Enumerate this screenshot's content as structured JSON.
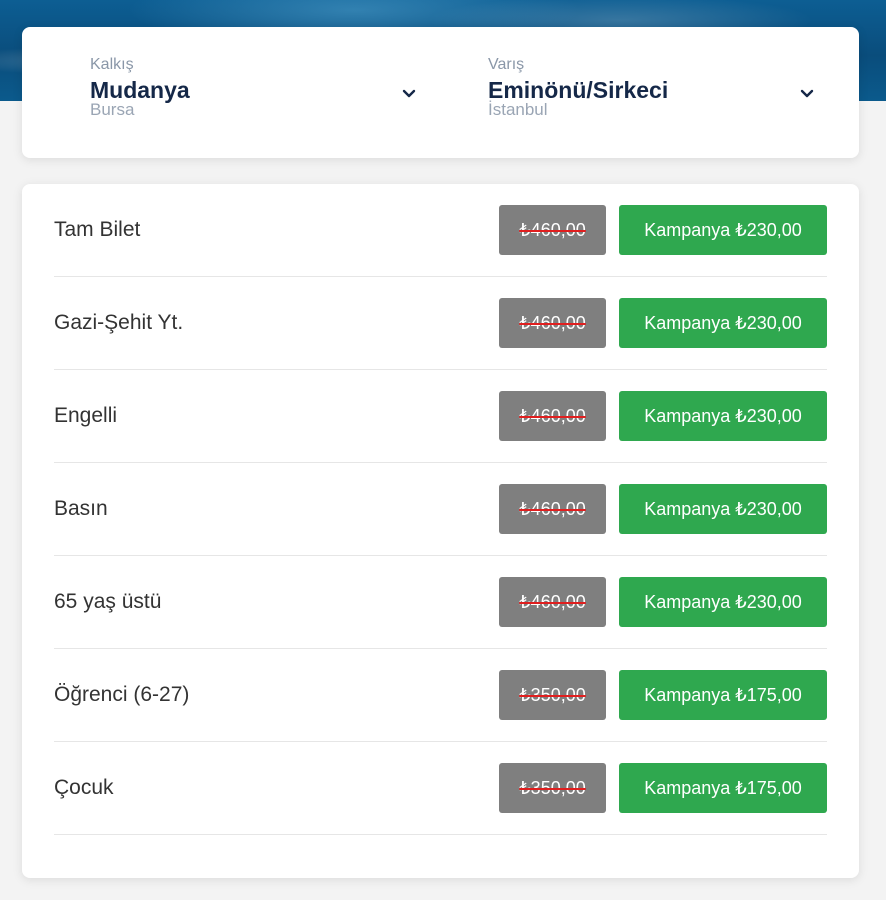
{
  "route": {
    "from": {
      "label": "Kalkış",
      "name": "Mudanya",
      "city": "Bursa"
    },
    "to": {
      "label": "Varış",
      "name": "Eminönü/Sirkeci",
      "city": "İstanbul"
    }
  },
  "tickets": [
    {
      "title": "Tam Bilet",
      "old_price": "₺460,00",
      "campaign": "Kampanya ₺230,00"
    },
    {
      "title": "Gazi-Şehit Yt.",
      "old_price": "₺460,00",
      "campaign": "Kampanya ₺230,00"
    },
    {
      "title": "Engelli",
      "old_price": "₺460,00",
      "campaign": "Kampanya ₺230,00"
    },
    {
      "title": "Basın",
      "old_price": "₺460,00",
      "campaign": "Kampanya ₺230,00"
    },
    {
      "title": "65 yaş üstü",
      "old_price": "₺460,00",
      "campaign": "Kampanya ₺230,00"
    },
    {
      "title": "Öğrenci (6-27)",
      "old_price": "₺350,00",
      "campaign": "Kampanya ₺175,00"
    },
    {
      "title": "Çocuk",
      "old_price": "₺350,00",
      "campaign": "Kampanya ₺175,00"
    }
  ],
  "colors": {
    "campaign_button": "#2fa84f",
    "old_price_bg": "#7f7f7f",
    "strike": "#e01f1f",
    "station_name": "#152848"
  },
  "icons": {
    "dropdown": "chevron-down-icon"
  }
}
